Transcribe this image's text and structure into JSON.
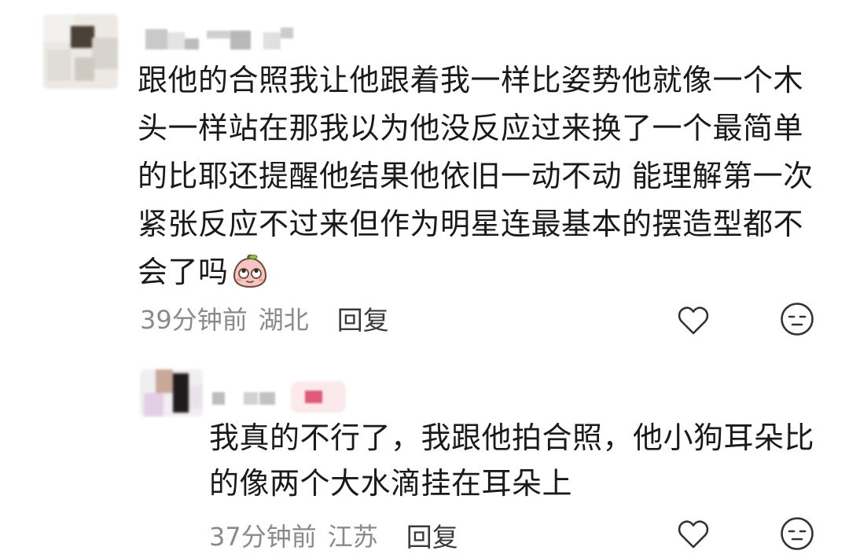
{
  "comments": [
    {
      "lines": [
        "跟他的合照我让他跟着我一样比姿势他就像一个木",
        "头一样站在那我以为他没反应过来换了一个最简单",
        "的比耶还提醒他结果他依旧一动不动 能理解第一次",
        "紧张反应不过来但作为明星连最基本的摆造型都不",
        "会了吗"
      ],
      "emoji": "peach-rolling-eyes-emoji",
      "time": "39分钟前",
      "region": "湖北",
      "reply_label": "回复"
    },
    {
      "lines": [
        "我真的不行了，我跟他拍合照，他小狗耳朵比",
        "的像两个大水滴挂在耳朵上"
      ],
      "time": "37分钟前",
      "region": "江苏",
      "reply_label": "回复"
    }
  ],
  "icons": {
    "like": "heart-outline-icon",
    "dislike": "meh-face-icon"
  },
  "colors": {
    "text": "#1a1a1a",
    "meta": "#8a8a8a",
    "reply": "#3a3a3a",
    "icon": "#333333",
    "background": "#ffffff"
  }
}
